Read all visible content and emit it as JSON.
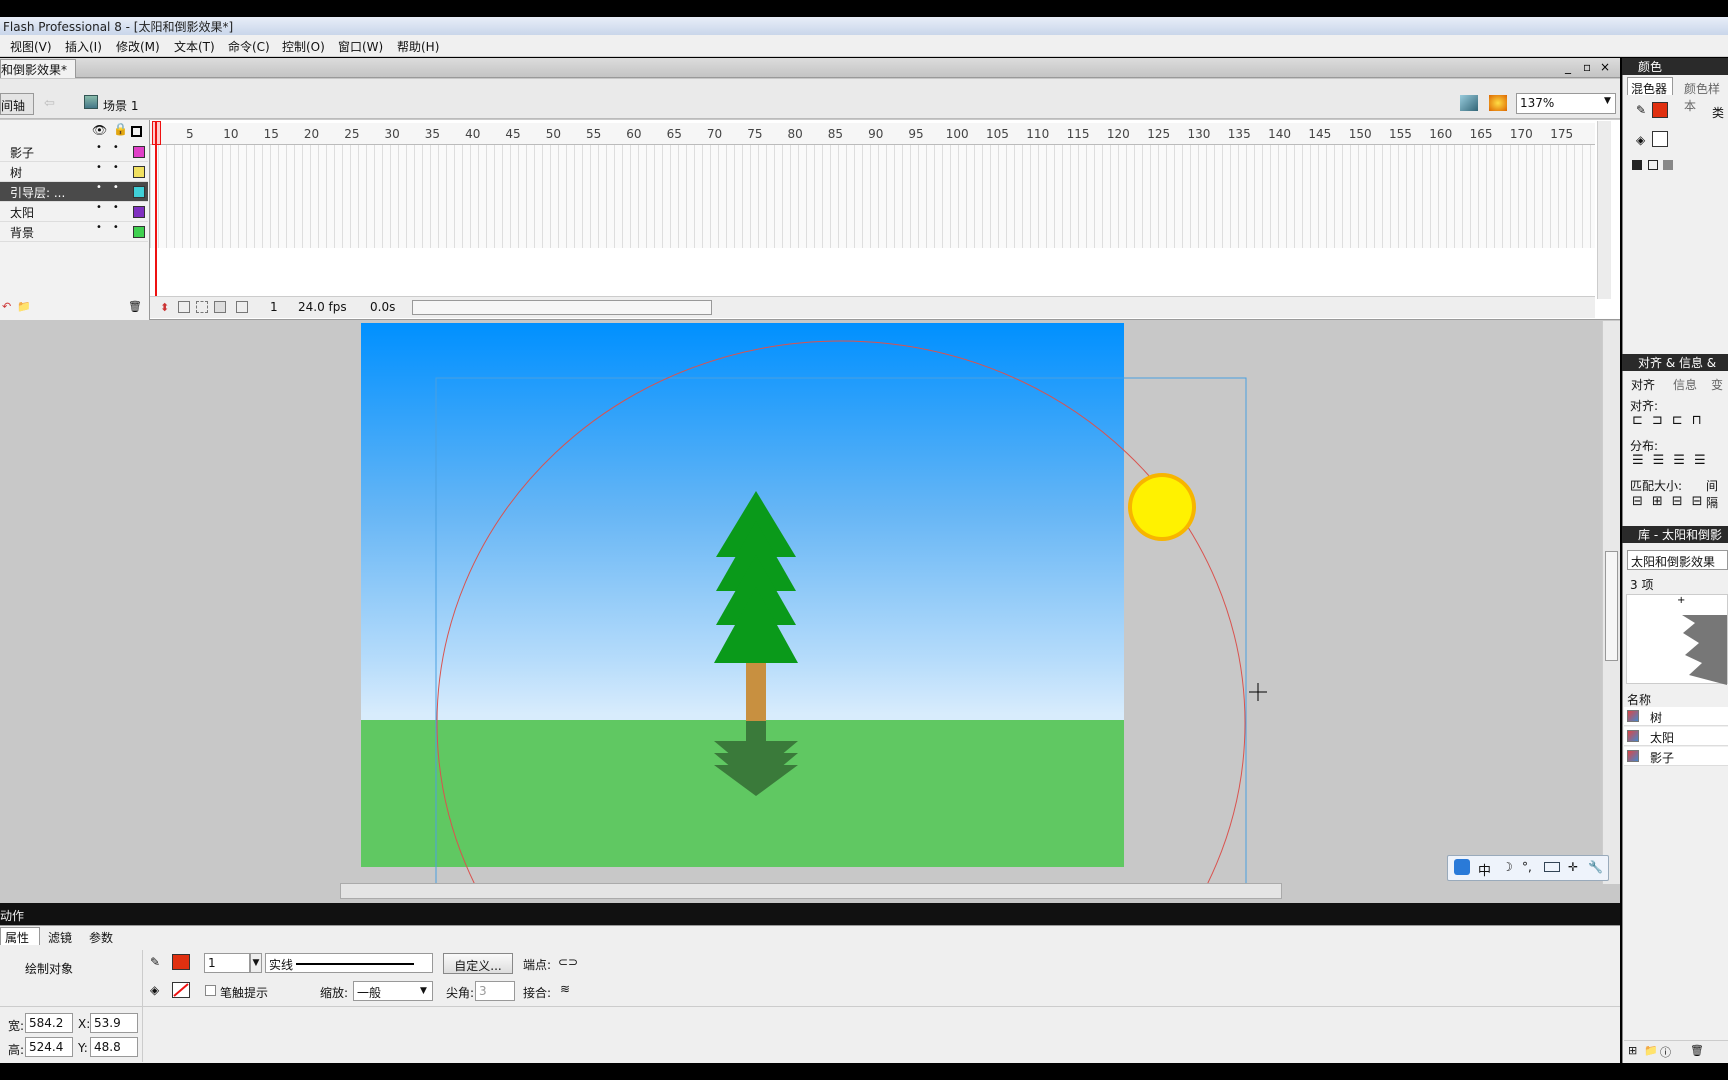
{
  "window": {
    "title": "Flash Professional 8 - [太阳和倒影效果*]"
  },
  "menu": [
    "视图(V)",
    "插入(I)",
    "修改(M)",
    "文本(T)",
    "命令(C)",
    "控制(O)",
    "窗口(W)",
    "帮助(H)"
  ],
  "document": {
    "tab": "和倒影效果*",
    "timeline_button": "间轴",
    "scene": "场景 1",
    "zoom": "137%",
    "win_buttons": [
      "_",
      "▫",
      "×"
    ]
  },
  "timeline": {
    "frame_numbers": [
      "5",
      "10",
      "15",
      "20",
      "25",
      "30",
      "35",
      "40",
      "45",
      "50",
      "55",
      "60",
      "65",
      "70",
      "75",
      "80",
      "85",
      "90",
      "95",
      "100",
      "105",
      "110",
      "115",
      "120",
      "125",
      "130",
      "135",
      "140",
      "145",
      "150",
      "155",
      "160",
      "165",
      "170",
      "175"
    ],
    "layers": [
      {
        "name": "影子",
        "color": "#e040c8",
        "selected": false
      },
      {
        "name": "树",
        "color": "#f0e060",
        "selected": false
      },
      {
        "name": "引导层: ...",
        "color": "#40d0d8",
        "selected": true
      },
      {
        "name": "太阳",
        "color": "#8030c0",
        "selected": false
      },
      {
        "name": "背景",
        "color": "#40d050",
        "selected": false
      }
    ],
    "current_frame": "1",
    "fps": "24.0 fps",
    "elapsed": "0.0s"
  },
  "actions_bar": "动作",
  "properties": {
    "tabs": [
      "属性",
      "滤镜",
      "参数"
    ],
    "object_type": "绘制对象",
    "stroke_height": "1",
    "stroke_style": "实线",
    "custom_button": "自定义...",
    "cap_label": "端点:",
    "stroke_hint_label": "笔触提示",
    "scale_label": "缩放:",
    "scale_value": "一般",
    "miter_label": "尖角:",
    "miter_value": "3",
    "join_label": "接合:",
    "w_label": "宽:",
    "w": "584.2",
    "h_label": "高:",
    "h": "524.4",
    "x_label": "X:",
    "x": "53.9",
    "y_label": "Y:",
    "y": "48.8"
  },
  "right_panels": {
    "color_header": "颜色",
    "color_tabs": [
      "混色器",
      "颜色样本"
    ],
    "type_label": "类",
    "align_header": "对齐 & 信息 &",
    "align_tabs": [
      "对齐",
      "信息",
      "变"
    ],
    "align_label": "对齐:",
    "distribute_label": "分布:",
    "match_label": "匹配大小:",
    "spacing_label": "间隔",
    "library_header": "库 - 太阳和倒影",
    "library_select": "太阳和倒影效果",
    "item_count": "3 项",
    "name_column": "名称",
    "items": [
      "树",
      "太阳",
      "影子"
    ]
  },
  "ime": {
    "mode": "中"
  },
  "colors": {
    "sky_top": "#0090ff",
    "ground": "#60c862",
    "tree": "#0a9a1a",
    "trunk": "#c89040",
    "sun": "#fff200",
    "guide_circle": "#d9534f"
  }
}
